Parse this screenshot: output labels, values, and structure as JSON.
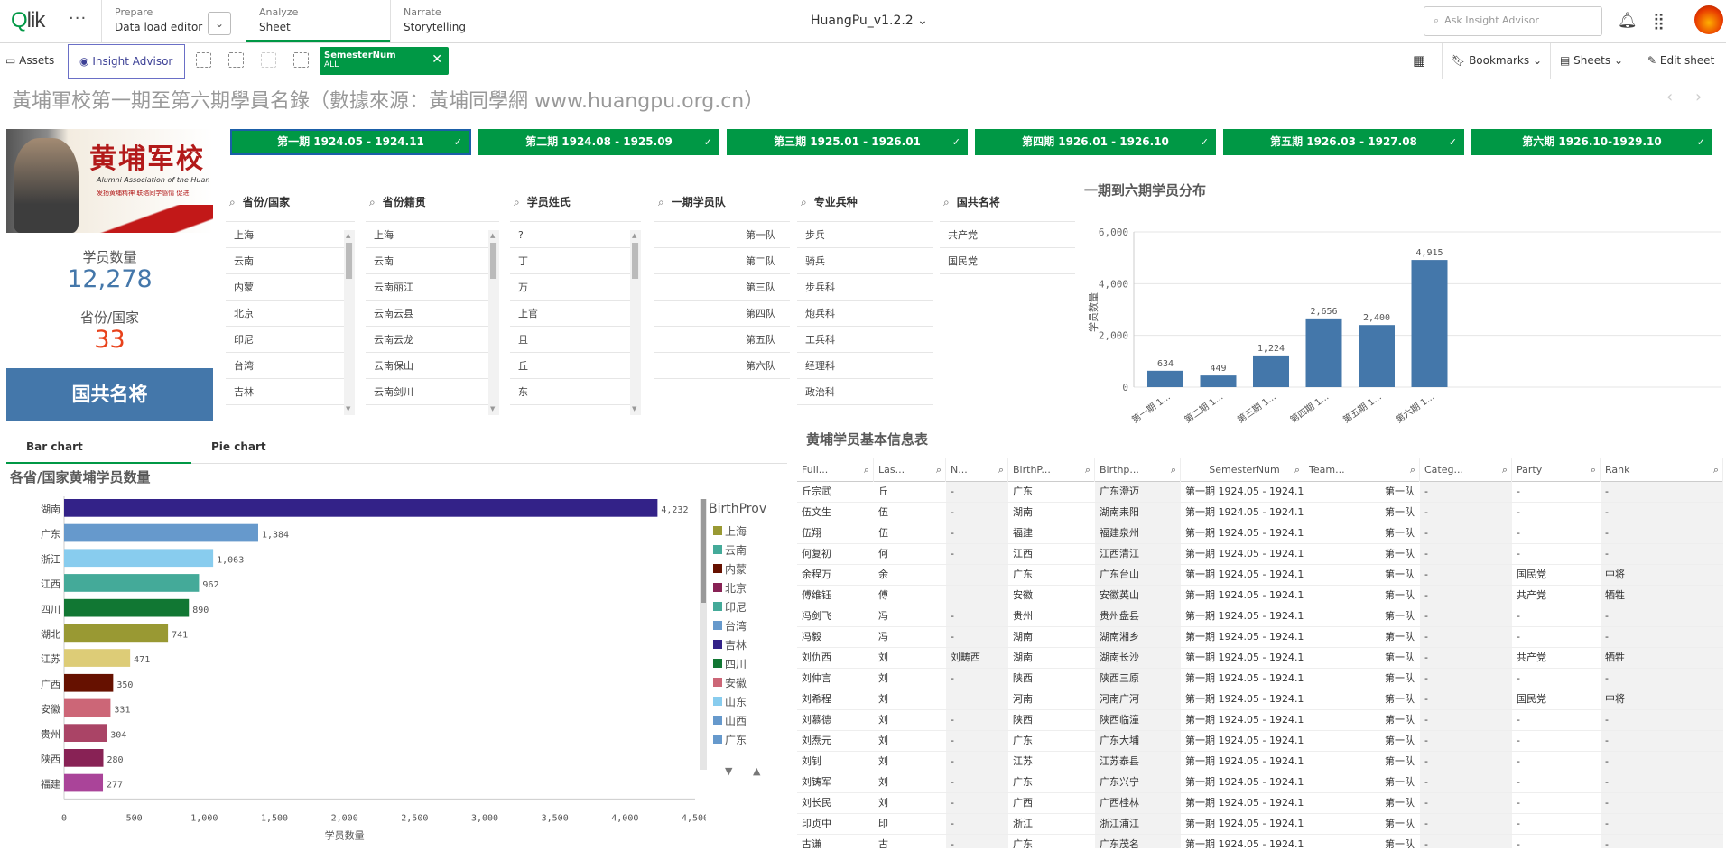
{
  "topbar": {
    "logo": "Qlik",
    "prepare": {
      "small": "Prepare",
      "main": "Data load editor"
    },
    "analyze": {
      "small": "Analyze",
      "main": "Sheet"
    },
    "narrate": {
      "small": "Narrate",
      "main": "Storytelling"
    },
    "app_title": "HuangPu_v1.2.2",
    "search_placeholder": "Ask Insight Advisor"
  },
  "toolbar": {
    "assets": "Assets",
    "insight_advisor": "Insight Advisor",
    "selection": {
      "field": "SemesterNum",
      "value": "ALL"
    },
    "bookmarks": "Bookmarks",
    "sheets": "Sheets",
    "edit_sheet": "Edit sheet"
  },
  "sheet_title": "黃埔軍校第一期至第六期學員名錄（數據來源：黃埔同學網 www.huangpu.org.cn）",
  "banner": {
    "calligraphy": "黄埔军校",
    "subtitle": "Alumni Association of the Huan",
    "slogan": "发扬黄埔精神 联络同学感情 促进"
  },
  "kpis": [
    {
      "label": "学员数量",
      "value": "12,278",
      "color": "#4477aa"
    },
    {
      "label": "省份/国家",
      "value": "33",
      "color": "#e8421b"
    }
  ],
  "party_button": "国共名将",
  "semesters": [
    "第一期 1924.05 - 1924.11",
    "第二期 1924.08 - 1925.09",
    "第三期 1925.01 - 1926.01",
    "第四期 1926.01 - 1926.10",
    "第五期 1926.03 - 1927.08",
    "第六期 1926.10-1929.10"
  ],
  "filters": [
    {
      "title": "省份/国家",
      "items": [
        "上海",
        "云南",
        "内蒙",
        "北京",
        "印尼",
        "台湾",
        "吉林"
      ]
    },
    {
      "title": "省份籍贯",
      "items": [
        "上海",
        "云南",
        "云南丽江",
        "云南云县",
        "云南云龙",
        "云南保山",
        "云南剑川"
      ]
    },
    {
      "title": "学员姓氏",
      "items": [
        "?",
        "丁",
        "万",
        "上官",
        "且",
        "丘",
        "东"
      ]
    },
    {
      "title": "一期学员队",
      "items": [
        "第一队",
        "第二队",
        "第三队",
        "第四队",
        "第五队",
        "第六队"
      ]
    },
    {
      "title": "专业兵种",
      "items": [
        "步兵",
        "骑兵",
        "步兵科",
        "炮兵科",
        "工兵科",
        "经理科",
        "政治科"
      ]
    },
    {
      "title": "国共名将",
      "items": [
        "共产党",
        "国民党"
      ]
    }
  ],
  "tabs": [
    "Bar chart",
    "Pie chart"
  ],
  "table_title": "黄埔学员基本信息表",
  "table": {
    "columns": [
      "Full...",
      "Las...",
      "N...",
      "BirthP...",
      "Birthp...",
      "SemesterNum",
      "Team...",
      "Categ...",
      "Party",
      "Rank"
    ],
    "rows": [
      [
        "丘宗武",
        "丘",
        "-",
        "广东",
        "广东澄迈",
        "第一期 1924.05 - 1924.11",
        "第一队",
        "-",
        "-",
        "-"
      ],
      [
        "伍文生",
        "伍",
        "-",
        "湖南",
        "湖南耒阳",
        "第一期 1924.05 - 1924.11",
        "第一队",
        "-",
        "-",
        "-"
      ],
      [
        "伍翔",
        "伍",
        "-",
        "福建",
        "福建泉州",
        "第一期 1924.05 - 1924.11",
        "第一队",
        "-",
        "-",
        "-"
      ],
      [
        "何复初",
        "何",
        "-",
        "江西",
        "江西清江",
        "第一期 1924.05 - 1924.11",
        "第一队",
        "-",
        "-",
        "-"
      ],
      [
        "余程万",
        "余",
        "",
        "广东",
        "广东台山",
        "第一期 1924.05 - 1924.11",
        "第一队",
        "-",
        "国民党",
        "中将"
      ],
      [
        "傅维钰",
        "傅",
        "",
        "安徽",
        "安徽英山",
        "第一期 1924.05 - 1924.11",
        "第一队",
        "-",
        "共产党",
        "牺牲"
      ],
      [
        "冯剑飞",
        "冯",
        "-",
        "贵州",
        "贵州盘县",
        "第一期 1924.05 - 1924.11",
        "第一队",
        "-",
        "-",
        "-"
      ],
      [
        "冯毅",
        "冯",
        "-",
        "湖南",
        "湖南湘乡",
        "第一期 1924.05 - 1924.11",
        "第一队",
        "-",
        "-",
        "-"
      ],
      [
        "刘仇西",
        "刘",
        "刘畴西",
        "湖南",
        "湖南长沙",
        "第一期 1924.05 - 1924.11",
        "第一队",
        "-",
        "共产党",
        "牺牲"
      ],
      [
        "刘仲言",
        "刘",
        "-",
        "陕西",
        "陕西三原",
        "第一期 1924.05 - 1924.11",
        "第一队",
        "-",
        "-",
        "-"
      ],
      [
        "刘希程",
        "刘",
        "",
        "河南",
        "河南广河",
        "第一期 1924.05 - 1924.11",
        "第一队",
        "-",
        "国民党",
        "中将"
      ],
      [
        "刘慕德",
        "刘",
        "-",
        "陕西",
        "陕西临潼",
        "第一期 1924.05 - 1924.11",
        "第一队",
        "-",
        "-",
        "-"
      ],
      [
        "刘焘元",
        "刘",
        "-",
        "广东",
        "广东大埔",
        "第一期 1924.05 - 1924.11",
        "第一队",
        "-",
        "-",
        "-"
      ],
      [
        "刘钊",
        "刘",
        "-",
        "江苏",
        "江苏泰县",
        "第一期 1924.05 - 1924.11",
        "第一队",
        "-",
        "-",
        "-"
      ],
      [
        "刘铸军",
        "刘",
        "-",
        "广东",
        "广东兴宁",
        "第一期 1924.05 - 1924.11",
        "第一队",
        "-",
        "-",
        "-"
      ],
      [
        "刘长民",
        "刘",
        "-",
        "广西",
        "广西桂林",
        "第一期 1924.05 - 1924.11",
        "第一队",
        "-",
        "-",
        "-"
      ],
      [
        "印贞中",
        "印",
        "-",
        "浙江",
        "浙江浦江",
        "第一期 1924.05 - 1924.11",
        "第一队",
        "-",
        "-",
        "-"
      ],
      [
        "古谦",
        "古",
        "-",
        "广东",
        "广东茂名",
        "第一期 1924.05 - 1924.11",
        "第一队",
        "-",
        "-",
        "-"
      ]
    ]
  },
  "chart_data": [
    {
      "type": "bar",
      "title": "一期到六期学员分布",
      "categories": [
        "第一期 1...",
        "第二期 1...",
        "第三期 1...",
        "第四期 1...",
        "第五期 1...",
        "第六期 1..."
      ],
      "values": [
        634,
        449,
        1224,
        2656,
        2400,
        4915
      ],
      "value_labels": [
        "634",
        "449",
        "1,224",
        "2,656",
        "2,400",
        "4,915"
      ],
      "ylabel": "学员数量",
      "xlabel": "",
      "ylim": [
        0,
        6000
      ],
      "yticks": [
        "0",
        "2,000",
        "4,000",
        "6,000"
      ],
      "color": "#4477aa",
      "grid": true
    },
    {
      "type": "bar",
      "orientation": "horizontal",
      "title": "各省/国家黄埔学员数量",
      "categories": [
        "湖南",
        "广东",
        "浙江",
        "江西",
        "四川",
        "湖北",
        "江苏",
        "广西",
        "安徽",
        "贵州",
        "陕西",
        "福建"
      ],
      "values": [
        4232,
        1384,
        1063,
        962,
        890,
        741,
        471,
        350,
        331,
        304,
        280,
        277
      ],
      "value_labels": [
        "4,232",
        "1,384",
        "1,063",
        "962",
        "890",
        "741",
        "471",
        "350",
        "331",
        "304",
        "280",
        "277"
      ],
      "colors": [
        "#332288",
        "#6699cc",
        "#88ccee",
        "#44aa99",
        "#117733",
        "#999933",
        "#ddcc77",
        "#661100",
        "#cc6677",
        "#aa4466",
        "#882255",
        "#aa4499"
      ],
      "xlabel": "学员数量",
      "ylabel": "",
      "xlim": [
        0,
        4500
      ],
      "xticks": [
        "0",
        "500",
        "1,000",
        "1,500",
        "2,000",
        "2,500",
        "3,000",
        "3,500",
        "4,000",
        "4,500"
      ],
      "legend_title": "BirthProv",
      "legend_position": "right",
      "legend": [
        {
          "name": "上海",
          "color": "#999933"
        },
        {
          "name": "云南",
          "color": "#44aa99"
        },
        {
          "name": "内蒙",
          "color": "#661100"
        },
        {
          "name": "北京",
          "color": "#882255"
        },
        {
          "name": "印尼",
          "color": "#44aa99"
        },
        {
          "name": "台湾",
          "color": "#6699cc"
        },
        {
          "name": "吉林",
          "color": "#332288"
        },
        {
          "name": "四川",
          "color": "#117733"
        },
        {
          "name": "安徽",
          "color": "#cc6677"
        },
        {
          "name": "山东",
          "color": "#88ccee"
        },
        {
          "name": "山西",
          "color": "#6699cc"
        },
        {
          "name": "广东",
          "color": "#6699cc"
        }
      ]
    }
  ]
}
